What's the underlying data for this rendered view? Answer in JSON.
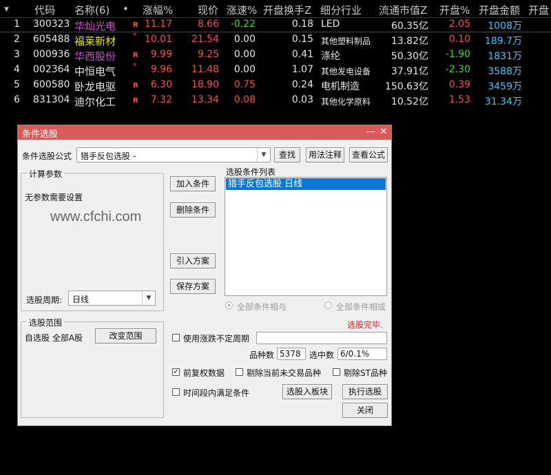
{
  "table": {
    "sort_marker": "▼",
    "headers": [
      "代码",
      "名称(6)",
      "•",
      "涨幅%",
      "现价",
      "涨速%",
      "开盘换手Z",
      "细分行业",
      "流通市值Z",
      "开盘%",
      "开盘金额",
      "开盘"
    ],
    "rows": [
      {
        "idx": "1",
        "code": "300323",
        "name": "华灿光电",
        "mark": "R",
        "chg": "11.17",
        "price": "8.66",
        "speed": "-0.22",
        "turnover": "0.18",
        "industry": "LED",
        "mcap": "60.35亿",
        "open_pct": "2.05",
        "open_amt": "1008万"
      },
      {
        "idx": "2",
        "code": "605488",
        "name": "福莱新材",
        "mark": "°",
        "chg": "10.01",
        "price": "21.54",
        "speed": "0.00",
        "turnover": "0.15",
        "industry": "其他塑料制品",
        "mcap": "13.82亿",
        "open_pct": "0.10",
        "open_amt": "189.7万"
      },
      {
        "idx": "3",
        "code": "000936",
        "name": "华西股份",
        "mark": "R",
        "chg": "9.99",
        "price": "9.25",
        "speed": "0.00",
        "turnover": "0.41",
        "industry": "涤纶",
        "mcap": "50.30亿",
        "open_pct": "-1.90",
        "open_amt": "1831万"
      },
      {
        "idx": "4",
        "code": "002364",
        "name": "中恒电气",
        "mark": "°",
        "chg": "9.96",
        "price": "11.48",
        "speed": "0.00",
        "turnover": "1.07",
        "industry": "其他发电设备",
        "mcap": "37.91亿",
        "open_pct": "-2.30",
        "open_amt": "3588万"
      },
      {
        "idx": "5",
        "code": "600580",
        "name": "卧龙电驱",
        "mark": "R",
        "chg": "6.30",
        "price": "18.90",
        "speed": "0.75",
        "turnover": "0.24",
        "industry": "电机制造",
        "mcap": "150.63亿",
        "open_pct": "0.39",
        "open_amt": "3459万"
      },
      {
        "idx": "6",
        "code": "831304",
        "name": "迪尔化工",
        "mark": "R",
        "chg": "7.32",
        "price": "13.34",
        "speed": "0.08",
        "turnover": "0.03",
        "industry": "其他化学原料",
        "mcap": "10.52亿",
        "open_pct": "1.53",
        "open_amt": "31.34万"
      }
    ]
  },
  "dialog": {
    "title": "条件选股",
    "min_glyph": "—",
    "close_glyph": "✕",
    "formula_label": "条件选股公式",
    "formula_value": "猎手反包选股 -",
    "find_btn": "查找",
    "usage_btn": "用法注释",
    "view_btn": "查看公式",
    "params_group": "计算参数",
    "params_text": "无参数需要设置",
    "watermark": "www.cfchi.com",
    "period_label": "选股周期:",
    "period_value": "日线",
    "add_btn": "加入条件",
    "del_btn": "删除条件",
    "import_btn": "引入方案",
    "save_btn": "保存方案",
    "list_label": "选股条件列表",
    "list_item": "猎手反包选股  日线",
    "radio_and": "全部条件相与",
    "radio_or": "全部条件相或",
    "status": "选股完毕.",
    "range_group": "选股范围",
    "range_value": "自选股 全部A股",
    "range_btn": "改变范围",
    "use_period_label": "使用涨跌不定周期",
    "count_label": "品种数",
    "count_value": "5378",
    "selected_label": "选中数",
    "selected_value": "6/0.1%",
    "fq_label": "前复权数据",
    "excl_no_trade_label": "剔除当前未交易品种",
    "excl_st_label": "剔除ST品种",
    "time_range_label": "时间段内满足条件",
    "to_board_btn": "选股入板块",
    "run_btn": "执行选股",
    "close_btn": "关闭",
    "check_mark": "✓",
    "arrow_glyph": "▼"
  }
}
